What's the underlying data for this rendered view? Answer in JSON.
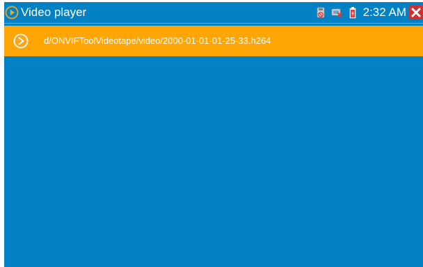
{
  "window": {
    "title": "Video player"
  },
  "statusbar": {
    "time": "2:32 AM",
    "icons": [
      "sd-card-icon",
      "network-disconnected-icon",
      "battery-charging-icon"
    ],
    "close_icon": "close-icon"
  },
  "file_list": {
    "items": [
      {
        "path": "d/ONVIFToolVideotape/video/2000-01-01-01-25-33.h264",
        "icon": "play-icon"
      }
    ]
  },
  "colors": {
    "background": "#0282c5",
    "selected_row": "#ffa505",
    "accent": "#f7a51b",
    "close": "#d32f2f"
  }
}
